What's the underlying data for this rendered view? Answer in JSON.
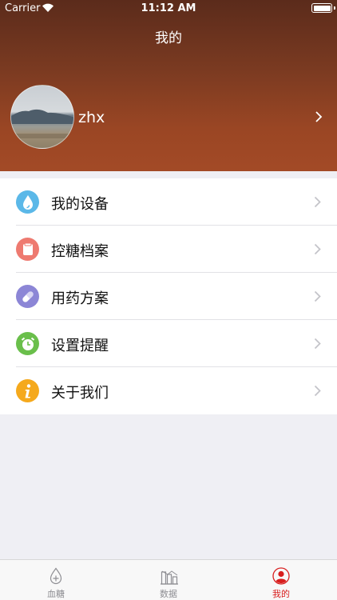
{
  "status_bar": {
    "carrier": "Carrier",
    "time": "11:12 AM"
  },
  "nav": {
    "title": "我的"
  },
  "profile": {
    "username": "zhx"
  },
  "menu": {
    "items": [
      {
        "label": "我的设备",
        "icon": "water-drop-icon",
        "color": "#5bb8e8"
      },
      {
        "label": "控糖档案",
        "icon": "document-icon",
        "color": "#ee7a70"
      },
      {
        "label": "用药方案",
        "icon": "pill-icon",
        "color": "#8c86d6"
      },
      {
        "label": "设置提醒",
        "icon": "alarm-clock-icon",
        "color": "#6abf4b"
      },
      {
        "label": "关于我们",
        "icon": "info-icon",
        "color": "#f5a91c"
      }
    ]
  },
  "tabbar": {
    "tabs": [
      {
        "label": "血糖",
        "icon": "blood-drop-icon",
        "active": false
      },
      {
        "label": "数据",
        "icon": "chart-icon",
        "active": false
      },
      {
        "label": "我的",
        "icon": "user-icon",
        "active": true
      }
    ],
    "active_color": "#d81e1e",
    "inactive_color": "#8e8e93"
  },
  "theme": {
    "header_gradient": [
      "#5b2b1b",
      "#a34a26"
    ],
    "background": "#efeff4"
  }
}
